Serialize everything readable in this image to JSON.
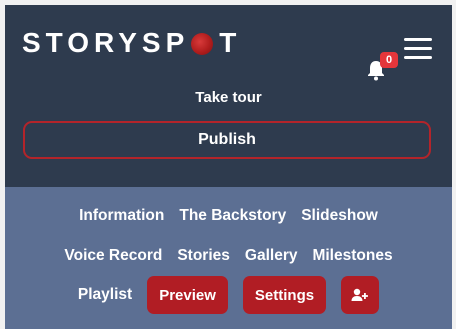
{
  "header": {
    "logo_text_left": "STORYSP",
    "logo_text_right": "T",
    "notification_count": "0",
    "take_tour_label": "Take tour",
    "publish_label": "Publish"
  },
  "nav": {
    "row1": [
      "Information",
      "The Backstory",
      "Slideshow"
    ],
    "row2": [
      "Voice Record",
      "Stories",
      "Gallery",
      "Milestones"
    ],
    "row3_link": "Playlist",
    "preview_label": "Preview",
    "settings_label": "Settings",
    "add_user_icon": "user-plus-icon"
  },
  "colors": {
    "header_bg": "#2e3b4e",
    "nav_bg": "#5c6f93",
    "accent_red": "#b11d24",
    "badge_red": "#e5363b"
  }
}
